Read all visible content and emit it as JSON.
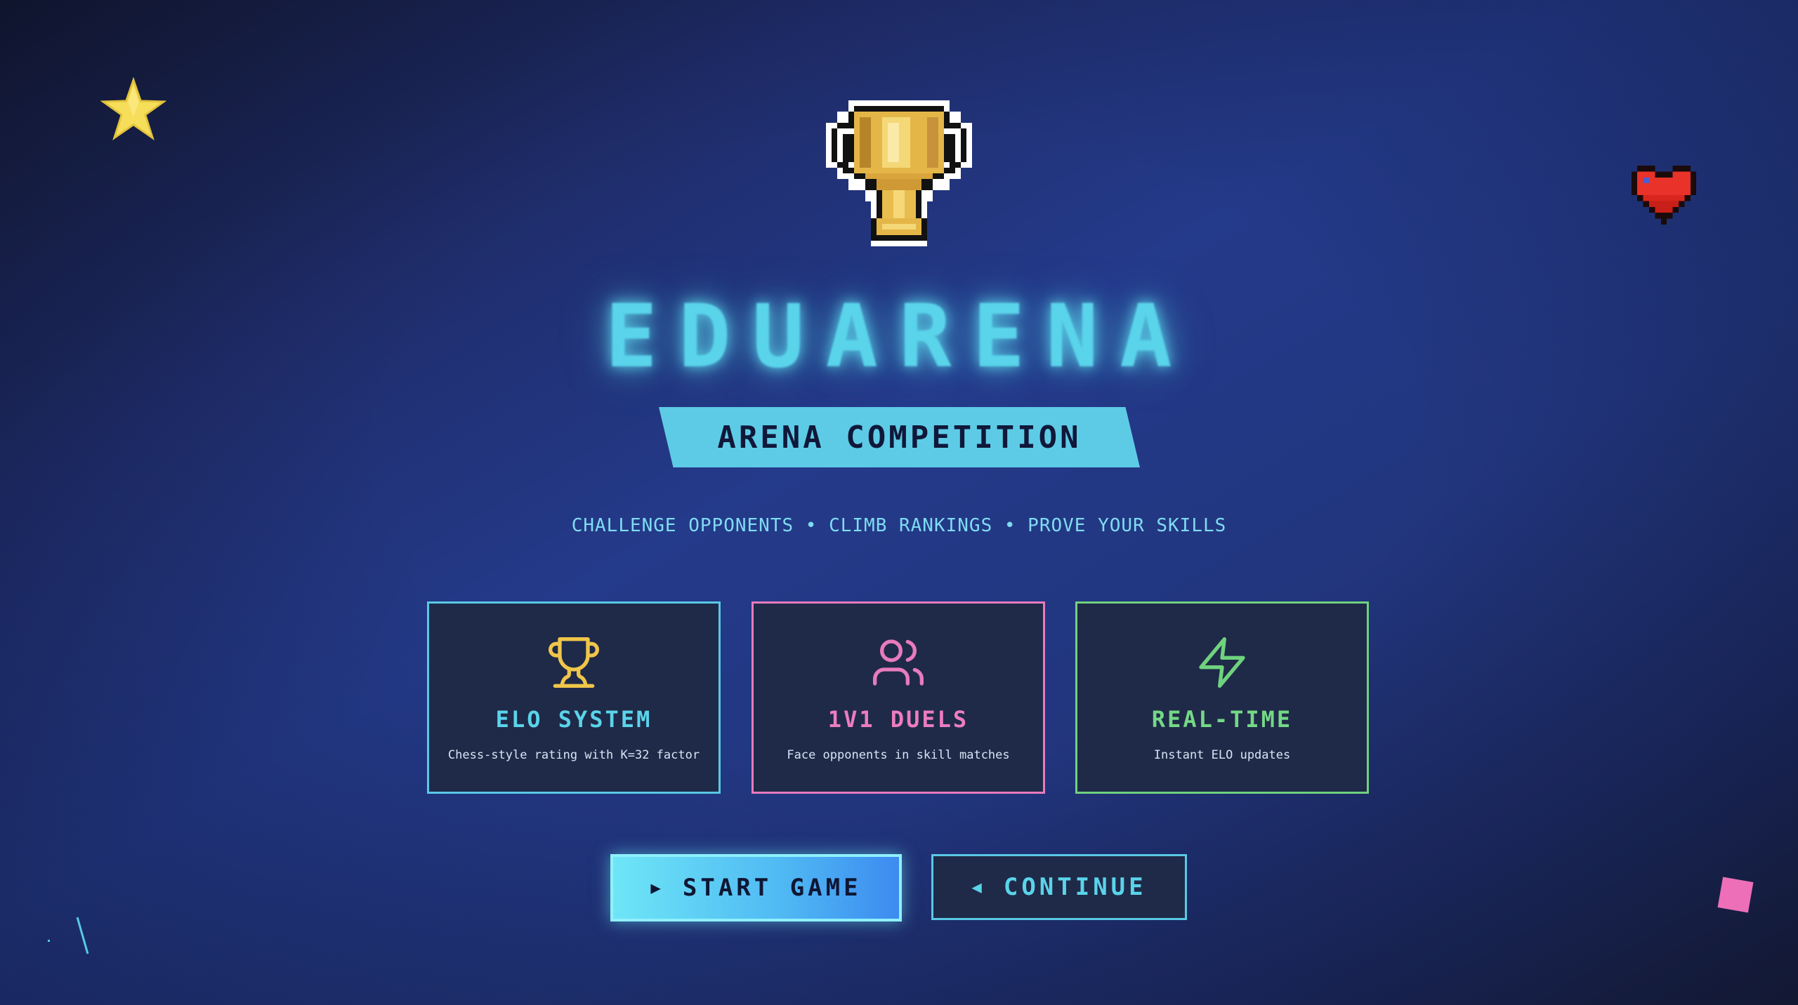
{
  "hero": {
    "title": "EDUARENA",
    "subtitle": "ARENA COMPETITION",
    "tagline": "CHALLENGE OPPONENTS • CLIMB RANKINGS • PROVE YOUR SKILLS",
    "logo_icon": "trophy-icon"
  },
  "features": [
    {
      "icon": "trophy-icon",
      "title": "ELO SYSTEM",
      "description": "Chess-style rating with K=32 factor",
      "color": "#58c9e6"
    },
    {
      "icon": "users-icon",
      "title": "1V1 DUELS",
      "description": "Face opponents in skill matches",
      "color": "#e77bbd"
    },
    {
      "icon": "lightning-icon",
      "title": "REAL-TIME",
      "description": "Instant ELO updates",
      "color": "#6fd27e"
    }
  ],
  "actions": {
    "start_label": "START GAME",
    "start_icon": "play-icon",
    "continue_label": "CONTINUE",
    "continue_icon": "back-arrow-icon"
  },
  "decorations": {
    "star": "star-icon",
    "heart": "heart-icon"
  },
  "colors": {
    "accent_cyan": "#5ad4ea",
    "accent_pink": "#e77bbd",
    "accent_green": "#6fd27e",
    "gold": "#f0c64a"
  }
}
